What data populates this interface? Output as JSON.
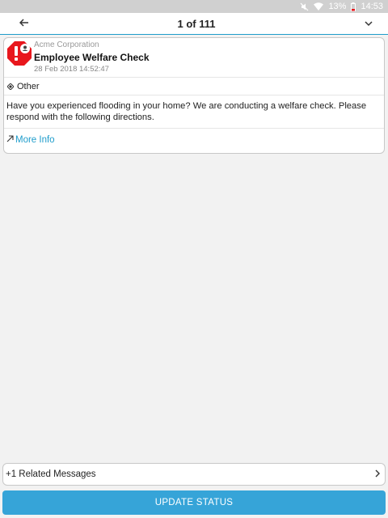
{
  "status_bar": {
    "battery_percent": "13%",
    "time": "14:53",
    "icons": [
      "mute-icon",
      "wifi-icon",
      "battery-low-icon"
    ]
  },
  "app_bar": {
    "title": "1 of 111",
    "back_icon": "arrow-left-icon",
    "menu_icon": "chevron-down-icon"
  },
  "message": {
    "sender": "Acme Corporation",
    "title": "Employee Welfare Check",
    "timestamp": "28 Feb 2018 14:52:47",
    "category": "Other",
    "body": "Have you experienced flooding in your home? We are conducting a welfare check. Please respond with the following directions.",
    "more_info_label": "More Info",
    "accent_color": "#1e9ccb",
    "alert_color": "#e8171d"
  },
  "related": {
    "label": "+1 Related Messages"
  },
  "actions": {
    "update_status_label": "UPDATE STATUS",
    "button_color": "#36a4d8"
  }
}
